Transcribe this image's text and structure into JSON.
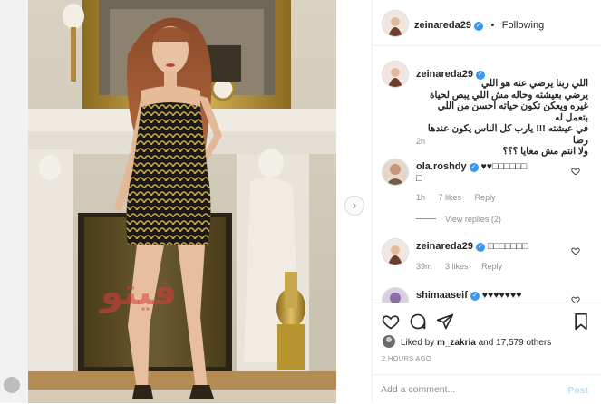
{
  "post": {
    "username": "zeinareda29",
    "follow_label": "Following",
    "caption_lines": [
      "اللي ربنا يرضي عنه هو اللي",
      "يرضي بعيشته وحاله مش اللي يبص لحياة",
      "غيره ويعكن تكون حياته احسن من اللي بتعمل له",
      "في عيشته !!! يارب كل الناس يكون عندها رضا",
      "ولا انتم مش معايا ؟؟؟"
    ],
    "caption_time": "2h",
    "watermark": "فيتو"
  },
  "comments": [
    {
      "username": "ola.roshdy",
      "text": "♥♥□□□□□□",
      "text2": "□",
      "time": "1h",
      "likes": "7 likes",
      "reply": "Reply",
      "view_replies": "View replies (2)"
    },
    {
      "username": "zeinareda29",
      "text": "□□□□□□□",
      "time": "39m",
      "likes": "3 likes",
      "reply": "Reply"
    },
    {
      "username": "shimaaseif",
      "text": "♥♥♥♥♥♥♥"
    }
  ],
  "footer": {
    "liked_by_prefix": "Liked by ",
    "liked_by_user": "m_zakria",
    "liked_by_suffix": " and 17,579 others",
    "time_ago": "2 HOURS AGO",
    "comment_placeholder": "Add a comment...",
    "post_label": "Post"
  },
  "colors": {
    "verified": "#3897f0",
    "post_disabled": "#b2dffc",
    "meta": "#8e8e8e"
  },
  "icons": [
    "heart-icon",
    "comment-icon",
    "share-icon",
    "bookmark-icon",
    "chevron-right-icon",
    "verified-icon"
  ]
}
